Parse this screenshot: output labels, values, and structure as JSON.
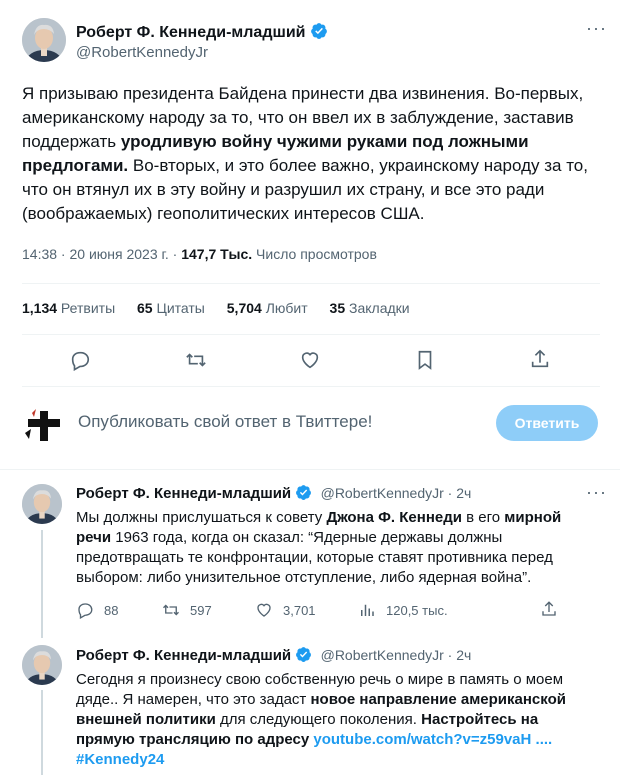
{
  "main_tweet": {
    "author_name": "Роберт Ф. Кеннеди-младший",
    "handle": "@RobertKennedyJr",
    "text_part1": "Я призываю президента Байдена принести два извинения. Во-первых, американскому народу за то, что он ввел их в заблуждение, заставив поддержать ",
    "text_bold": "уродливую войну чужими руками под ложными предлогами.",
    "text_part2": " Во-вторых, и это более важно, украинскому народу за то, что он втянул их в эту войну и разрушил их страну, и все это ради (воображаемых) геополитических интересов США.",
    "timestamp": "14:38 · 20 июня 2023 г. · ",
    "views_count": "147,7 Тыс.",
    "views_label": " Число просмотров",
    "stats": {
      "retweets_count": "1,134",
      "retweets_label": " Ретвиты",
      "quotes_count": "65",
      "quotes_label": " Цитаты",
      "likes_count": "5,704",
      "likes_label": " Любит",
      "bookmarks_count": "35",
      "bookmarks_label": " Закладки"
    }
  },
  "compose": {
    "placeholder": "Опубликовать свой ответ в Твиттере!",
    "button_label": "Ответить"
  },
  "replies": [
    {
      "author_name": "Роберт Ф. Кеннеди-младший",
      "handle": "@RobertKennedyJr · 2ч",
      "t1": "Мы должны прислушаться к совету ",
      "b1": "Джона Ф. Кеннеди",
      "t2": " в его ",
      "b2": "мирной речи",
      "t3": " 1963 года, когда он сказал: “Ядерные державы должны предотвращать те конфронтации, которые ставят противника перед выбором: либо унизительное отступление, либо ядерная война”.",
      "replies_count": "88",
      "retweets_count": "597",
      "likes_count": "3,701",
      "views_count": "120,5 тыс."
    },
    {
      "author_name": "Роберт Ф. Кеннеди-младший",
      "handle": "@RobertKennedyJr · 2ч",
      "t1": "Сегодня я произнесу свою собственную речь о мире в память о моем дяде.. Я намерен, что это задаст ",
      "b1": "новое направление американской внешней политики",
      "t2": " для следующего поколения. ",
      "b2": "Настройтесь на прямую трансляцию по адресу",
      "t3": " ",
      "link": "youtube.com/watch?v=z59vaH ....",
      "hashtag": "#Kennedy24"
    }
  ],
  "colors": {
    "accent": "#1d9bf0",
    "verified": "#1d9bf0",
    "reply_button": "#8ecdf8",
    "muted": "#536471"
  }
}
